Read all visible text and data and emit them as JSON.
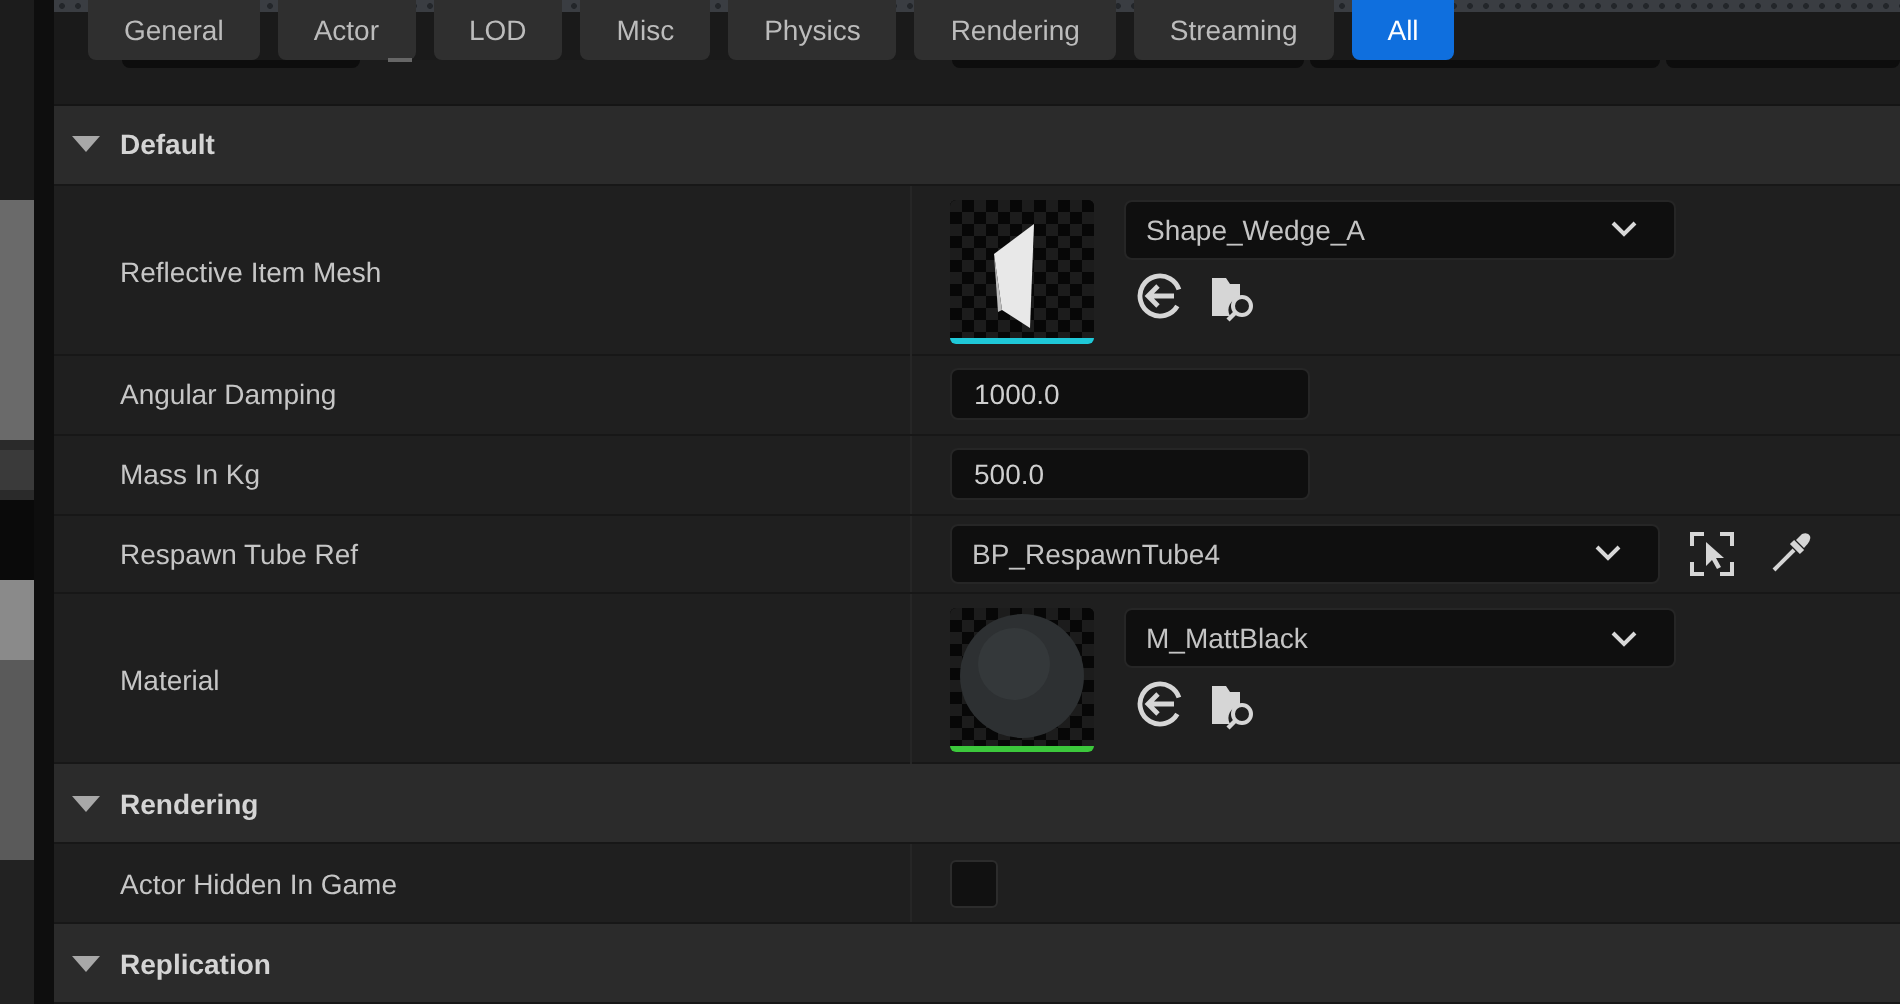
{
  "tabs": [
    {
      "label": "General",
      "selected": false
    },
    {
      "label": "Actor",
      "selected": false
    },
    {
      "label": "LOD",
      "selected": false
    },
    {
      "label": "Misc",
      "selected": false
    },
    {
      "label": "Physics",
      "selected": false
    },
    {
      "label": "Rendering",
      "selected": false
    },
    {
      "label": "Streaming",
      "selected": false
    },
    {
      "label": "All",
      "selected": true
    }
  ],
  "sections": [
    {
      "title": "Default",
      "expanded": true,
      "rows": [
        {
          "kind": "mesh_asset",
          "label": "Reflective Item Mesh",
          "color": "#1fc8d8",
          "value": "Shape_Wedge_A"
        },
        {
          "kind": "number",
          "label": "Angular Damping",
          "value": "1000.0"
        },
        {
          "kind": "number",
          "label": "Mass In Kg",
          "value": "500.0"
        },
        {
          "kind": "picker",
          "label": "Respawn Tube Ref",
          "value": "BP_RespawnTube4"
        },
        {
          "kind": "material_asset",
          "label": "Material",
          "color": "#3cc83c",
          "value": "M_MattBlack"
        }
      ]
    },
    {
      "title": "Rendering",
      "expanded": true,
      "rows": [
        {
          "kind": "checkbox",
          "label": "Actor Hidden In Game",
          "checked": false
        }
      ]
    },
    {
      "title": "Replication",
      "expanded": true
    }
  ]
}
